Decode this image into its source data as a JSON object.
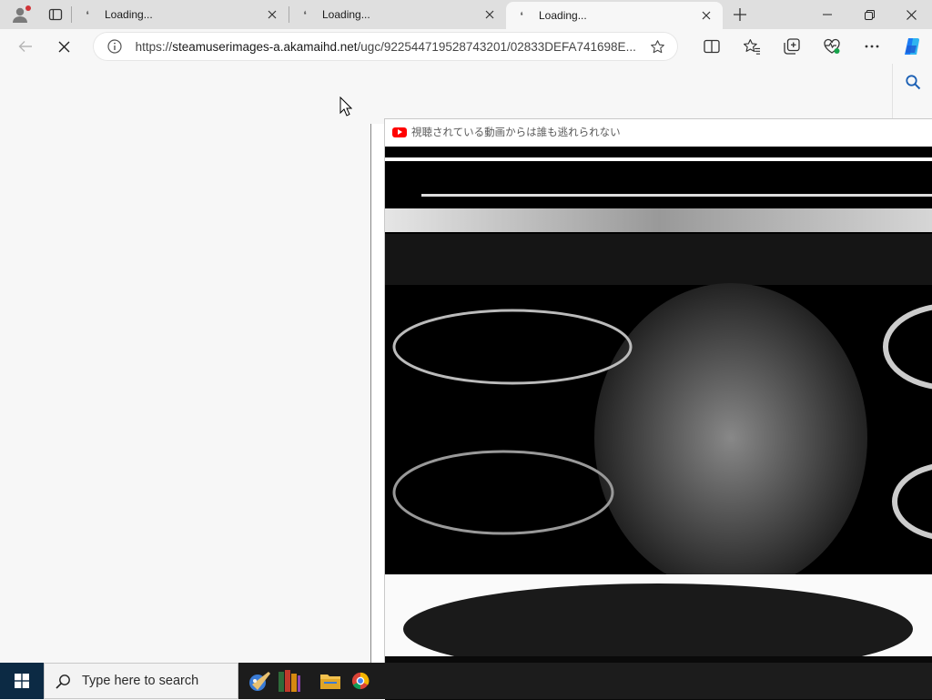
{
  "tabs": [
    {
      "title": "Loading...",
      "active": false
    },
    {
      "title": "Loading...",
      "active": false
    },
    {
      "title": "Loading...",
      "active": true
    }
  ],
  "address": {
    "url_prefix": "https://",
    "url_host": "steamuserimages-a.akamaihd.net",
    "url_path": "/ugc/922544719528743201/02833DEFA741698E..."
  },
  "popup": {
    "title": "視聴されている動画からは誰も逃れられない"
  },
  "taskbar": {
    "search_placeholder": "Type here to search"
  },
  "icons": {
    "profile": "profile-icon",
    "tab_actions": "tab-actions-icon",
    "tab_favicon": "loading-favicon-icon",
    "close": "close-icon",
    "new_tab": "plus-icon",
    "minimize": "minimize-icon",
    "restore": "restore-icon",
    "window_close": "window-close-icon",
    "back": "back-arrow-icon",
    "stop": "stop-icon",
    "site_info": "info-icon",
    "favorite_star": "star-icon",
    "split_screen": "split-screen-icon",
    "favorites": "favorites-icon",
    "collections": "collections-icon",
    "performance": "heart-pulse-icon",
    "more": "more-icon",
    "copilot": "copilot-icon",
    "sidebar_search": "search-icon",
    "youtube": "youtube-icon",
    "windows_start": "windows-logo-icon",
    "taskbar_search": "search-icon"
  },
  "colors": {
    "tabstrip_bg": "#dfdfdf",
    "page_bg": "#f7f7f7",
    "taskbar_bg": "#1c1c1c",
    "youtube_red": "#ff0000",
    "profile_dot": "#d13438"
  }
}
